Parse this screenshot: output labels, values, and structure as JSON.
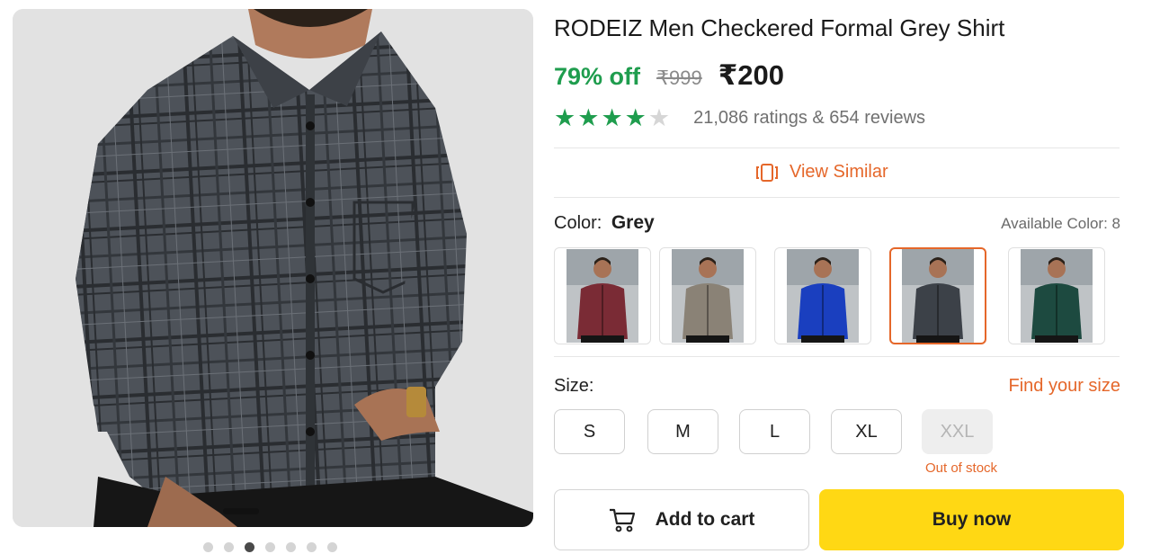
{
  "product": {
    "title": "RODEIZ Men Checkered Formal Grey Shirt",
    "discount": "79% off",
    "mrp": "₹999",
    "price": "₹200",
    "rating_value": 4,
    "rating_max": 5,
    "ratings_text": "21,086 ratings & 654 reviews"
  },
  "gallery": {
    "image_count": 7,
    "active_index": 2
  },
  "view_similar": {
    "label": "View Similar",
    "icon": "view-similar-icon"
  },
  "color": {
    "label": "Color:",
    "selected": "Grey",
    "available_label": "Available Color: 8",
    "swatches": [
      {
        "name": "maroon",
        "shirt": "#7a2b35"
      },
      {
        "name": "beige-check",
        "shirt": "#8a8276"
      },
      {
        "name": "blue",
        "shirt": "#1a3fbf"
      },
      {
        "name": "grey",
        "shirt": "#3c4148",
        "selected": true
      },
      {
        "name": "green",
        "shirt": "#1d4a40"
      }
    ]
  },
  "size": {
    "label": "Size:",
    "find_label": "Find your size",
    "options": [
      {
        "label": "S",
        "in_stock": true
      },
      {
        "label": "M",
        "in_stock": true
      },
      {
        "label": "L",
        "in_stock": true
      },
      {
        "label": "XL",
        "in_stock": true
      },
      {
        "label": "XXL",
        "in_stock": false
      }
    ],
    "out_of_stock_note": "Out of stock"
  },
  "actions": {
    "add_to_cart": "Add to cart",
    "buy_now": "Buy now"
  },
  "colors": {
    "green": "#1f9d4e",
    "accent": "#e5672a",
    "buy": "#ffd814"
  }
}
